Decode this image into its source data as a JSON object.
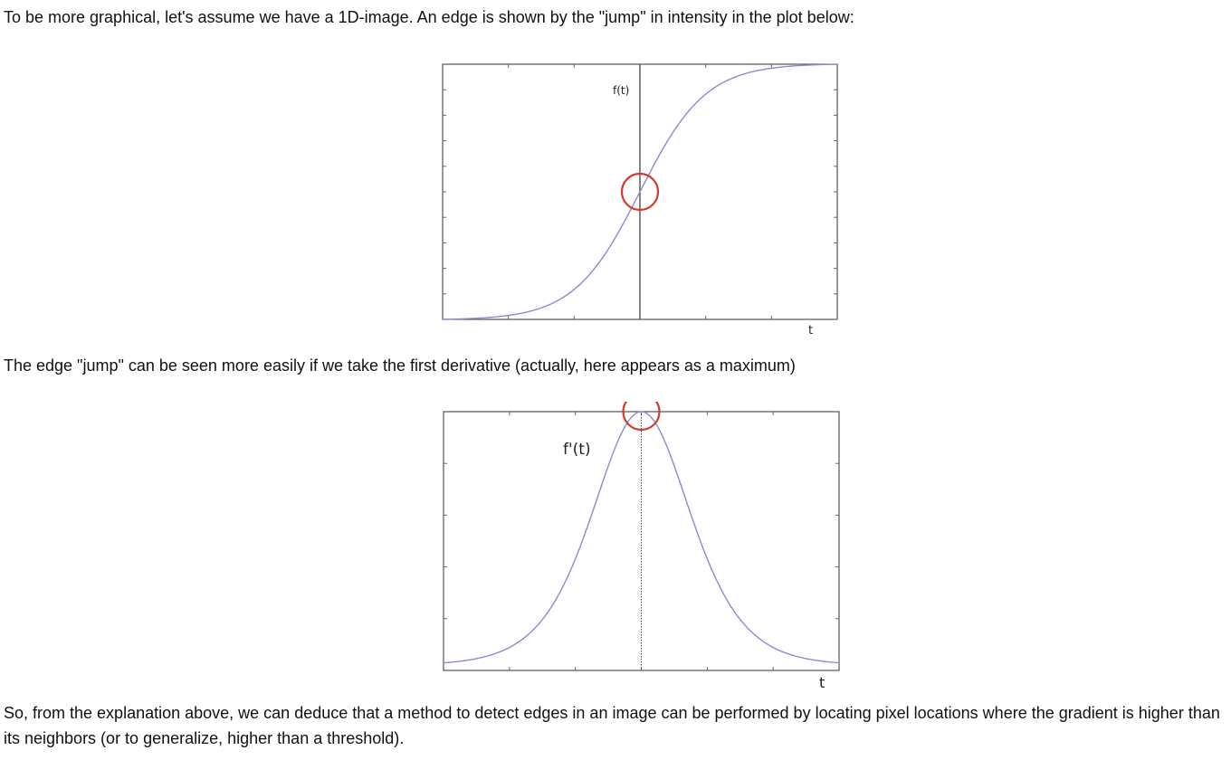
{
  "paragraphs": {
    "intro": "To be more graphical, let's assume we have a 1D-image. An edge is shown by the \"jump\" in intensity in the plot below:",
    "derivative": "The edge \"jump\" can be seen more easily if we take the first derivative (actually, here appears as a maximum)",
    "conclusion": "So, from the explanation above, we can deduce that a method to detect edges in an image can be performed by locating pixel locations where the gradient is higher than its neighbors (or to generalize, higher than a threshold)."
  },
  "chart_data": [
    {
      "type": "line",
      "function_label": "f(t)",
      "xlabel": "t",
      "curve": "sigmoid",
      "x_range": [
        -6,
        6
      ],
      "series": [
        {
          "x": [
            -6,
            -5,
            -4,
            -3,
            -2,
            -1,
            0,
            1,
            2,
            3,
            4,
            5,
            6
          ],
          "values": [
            0.0,
            0.007,
            0.018,
            0.047,
            0.119,
            0.269,
            0.5,
            0.731,
            0.881,
            0.953,
            0.982,
            0.993,
            1.0
          ]
        }
      ],
      "highlight": {
        "x": 0,
        "y": 0.5,
        "meaning": "edge jump"
      },
      "grid": false,
      "colors": {
        "curve": "#8a8ad6",
        "axis": "#444444",
        "highlight": "#d23b2a"
      }
    },
    {
      "type": "line",
      "function_label": "f'(t)",
      "xlabel": "t",
      "curve": "sigmoid-derivative",
      "x_range": [
        -6,
        6
      ],
      "series": [
        {
          "x": [
            -6,
            -5,
            -4,
            -3,
            -2,
            -1,
            0,
            1,
            2,
            3,
            4,
            5,
            6
          ],
          "values": [
            0.0,
            0.026,
            0.07,
            0.177,
            0.42,
            0.787,
            1.0,
            0.787,
            0.42,
            0.177,
            0.07,
            0.026,
            0.0
          ]
        }
      ],
      "highlight": {
        "x": 0,
        "y": 1.0,
        "meaning": "maximum"
      },
      "grid": false,
      "colors": {
        "curve": "#8a8ad6",
        "axis": "#444444",
        "highlight": "#d23b2a"
      }
    }
  ]
}
